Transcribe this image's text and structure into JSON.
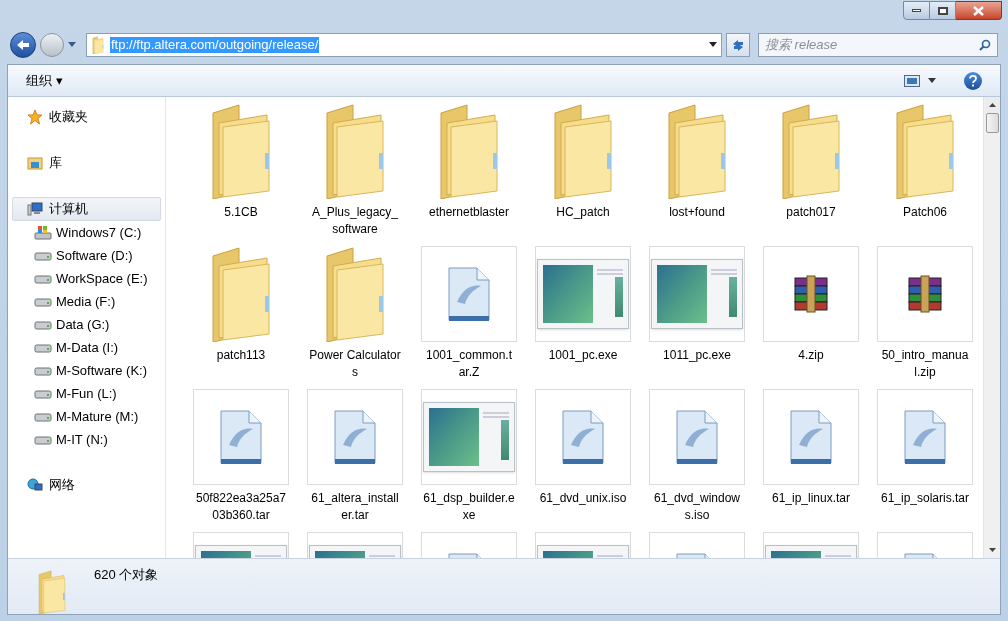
{
  "address": {
    "value": "ftp://ftp.altera.com/outgoing/release/",
    "selected": true
  },
  "search": {
    "placeholder": "搜索 release"
  },
  "toolbar": {
    "organize": "组织 ▾"
  },
  "sidebar": {
    "items": [
      {
        "label": "收藏夹",
        "kind": "favorites",
        "selected": false
      },
      {
        "label": "库",
        "kind": "library",
        "selected": false
      },
      {
        "label": "计算机",
        "kind": "computer",
        "selected": true,
        "children": [
          {
            "label": "Windows7 (C:)",
            "kind": "system"
          },
          {
            "label": "Software (D:)",
            "kind": "drive"
          },
          {
            "label": "WorkSpace (E:)",
            "kind": "drive"
          },
          {
            "label": "Media (F:)",
            "kind": "drive"
          },
          {
            "label": "Data (G:)",
            "kind": "drive"
          },
          {
            "label": "M-Data (I:)",
            "kind": "drive"
          },
          {
            "label": "M-Software (K:)",
            "kind": "drive"
          },
          {
            "label": "M-Fun (L:)",
            "kind": "drive"
          },
          {
            "label": "M-Mature (M:)",
            "kind": "drive"
          },
          {
            "label": "M-IT (N:)",
            "kind": "drive"
          }
        ]
      },
      {
        "label": "网络",
        "kind": "network",
        "selected": false
      }
    ]
  },
  "files": [
    {
      "name": "5.1CB",
      "kind": "folder"
    },
    {
      "name": "A_Plus_legacy_software",
      "kind": "folder"
    },
    {
      "name": "ethernetblaster",
      "kind": "folder"
    },
    {
      "name": "HC_patch",
      "kind": "folder"
    },
    {
      "name": "lost+found",
      "kind": "folder"
    },
    {
      "name": "patch017",
      "kind": "folder"
    },
    {
      "name": "Patch06",
      "kind": "folder"
    },
    {
      "name": "patch113",
      "kind": "folder"
    },
    {
      "name": "Power Calculators",
      "kind": "folder"
    },
    {
      "name": "1001_common.tar.Z",
      "kind": "file"
    },
    {
      "name": "1001_pc.exe",
      "kind": "app"
    },
    {
      "name": "1011_pc.exe",
      "kind": "app"
    },
    {
      "name": "4.zip",
      "kind": "zip"
    },
    {
      "name": "50_intro_manual.zip",
      "kind": "zip"
    },
    {
      "name": "50f822ea3a25a703b360.tar",
      "kind": "file"
    },
    {
      "name": "61_altera_installer.tar",
      "kind": "file"
    },
    {
      "name": "61_dsp_builder.exe",
      "kind": "app"
    },
    {
      "name": "61_dvd_unix.iso",
      "kind": "file"
    },
    {
      "name": "61_dvd_windows.iso",
      "kind": "file"
    },
    {
      "name": "61_ip_linux.tar",
      "kind": "file"
    },
    {
      "name": "61_ip_solaris.tar",
      "kind": "file"
    },
    {
      "kind": "app"
    },
    {
      "kind": "app"
    },
    {
      "kind": "file"
    },
    {
      "kind": "app"
    },
    {
      "kind": "file"
    },
    {
      "kind": "app"
    },
    {
      "kind": "file"
    }
  ],
  "status_bar": {
    "count": "620 个对象"
  }
}
